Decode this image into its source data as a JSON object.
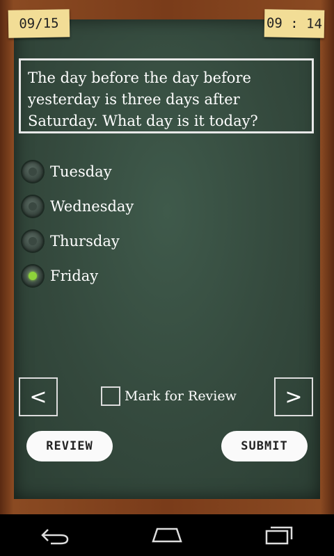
{
  "header": {
    "progress": "09/15",
    "timer": "09 : 14"
  },
  "question": {
    "text": "The day before the day before yesterday is three days after Saturday. What day is it today?"
  },
  "options": [
    {
      "label": "Tuesday",
      "selected": false
    },
    {
      "label": "Wednesday",
      "selected": false
    },
    {
      "label": "Thursday",
      "selected": false
    },
    {
      "label": "Friday",
      "selected": true
    }
  ],
  "controls": {
    "prev_label": "<",
    "next_label": ">",
    "mark_label": "Mark for Review",
    "review_label": "REVIEW",
    "submit_label": "SUBMIT"
  },
  "colors": {
    "selected_accent": "#8ed33a",
    "board": "#34493d",
    "note": "#f2dd96"
  }
}
